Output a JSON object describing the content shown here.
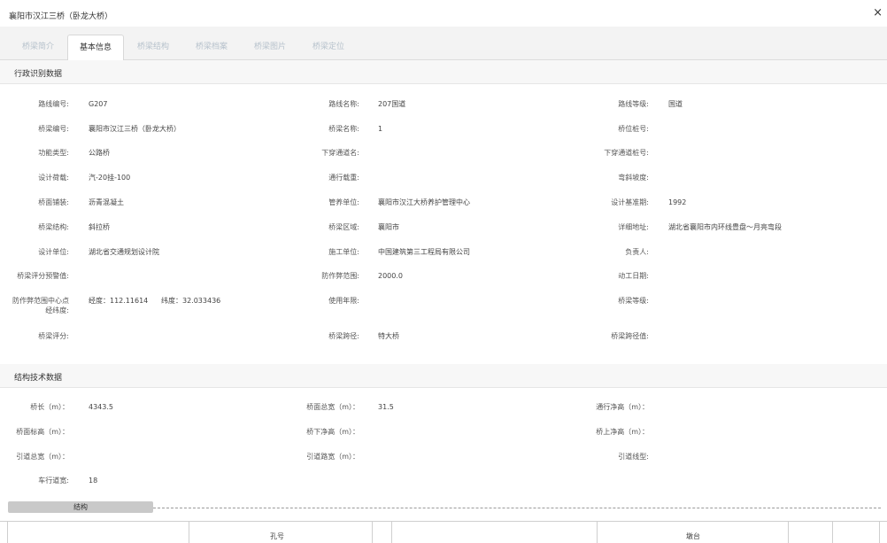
{
  "window": {
    "title": "襄阳市汉江三桥（卧龙大桥）",
    "close_symbol": "×"
  },
  "tabs": [
    {
      "label": "桥梁简介",
      "active": false
    },
    {
      "label": "基本信息",
      "active": true
    },
    {
      "label": "桥梁结构",
      "active": false
    },
    {
      "label": "桥梁档案",
      "active": false
    },
    {
      "label": "桥梁图片",
      "active": false
    },
    {
      "label": "桥梁定位",
      "active": false
    }
  ],
  "admin": {
    "heading": "行政识别数据",
    "route_no_label": "路线编号:",
    "route_no": "G207",
    "route_name_label": "路线名称:",
    "route_name": "207国道",
    "route_grade_label": "路线等级:",
    "route_grade": "国道",
    "bridge_no_label": "桥梁编号:",
    "bridge_no": "襄阳市汉江三桥（卧龙大桥）",
    "bridge_name_label": "桥梁名称:",
    "bridge_name": "1",
    "stake_label": "桥位桩号:",
    "function_type_label": "功能类型:",
    "function_type": "公路桥",
    "under_pass_name_label": "下穿通道名:",
    "under_pass_stake_label": "下穿通道桩号:",
    "design_load_label": "设计荷载:",
    "design_load": "汽-20挂-100",
    "traffic_load_label": "通行载重:",
    "skew_label": "弯斜坡度:",
    "deck_paving_label": "桥面铺装:",
    "deck_paving": "沥青混凝土",
    "maintain_unit_label": "管养单位:",
    "maintain_unit": "襄阳市汉江大桥养护管理中心",
    "design_ref_label": "设计基准期:",
    "design_ref": "1992",
    "structure_label": "桥梁结构:",
    "structure": "斜拉桥",
    "region_label": "桥梁区域:",
    "region": "襄阳市",
    "address_label": "详细地址:",
    "address": "湖北省襄阳市内环线豊盘～月亮弯段",
    "design_unit_label": "设计单位:",
    "design_unit": "湖北省交通规划设计院",
    "construction_unit_label": "施工单位:",
    "construction_unit": "中国建筑第三工程局有限公司",
    "leader_label": "负责人:",
    "warning_label": "桥梁评分预警值:",
    "flood_range_label": "防作弊范围:",
    "flood_range": "2000.0",
    "start_date_label": "动工日期:",
    "center_label": "防作弊范围中心点经纬度:",
    "lon_text": "经度：112.11614",
    "lat_text": "纬度：32.033436",
    "service_life_label": "使用年限:",
    "bridge_grade_label": "桥梁等级:",
    "score_label": "桥梁评分:",
    "span_label": "桥梁跨径:",
    "span": "特大桥",
    "span_value_label": "桥梁跨径值:"
  },
  "tech": {
    "heading": "结构技术数据",
    "length_label": "桥长（m）：",
    "length": "4343.5",
    "deck_width_label": "桥面总宽（m）：",
    "deck_width": "31.5",
    "clear_height_label": "通行净高（m）：",
    "deck_elev_label": "桥面标高（m）：",
    "under_clear_label": "桥下净高（m）：",
    "over_clear_label": "桥上净高（m）：",
    "approach_width_label": "引道总宽（m）：",
    "approach_road_label": "引道路宽（m）：",
    "approach_line_label": "引道线型:",
    "lane_width_label": "车行道宽:",
    "lane_width": "18"
  },
  "subsection": {
    "tab_label": "结构"
  },
  "grid": {
    "col1": "孔号",
    "col2": "墩台"
  }
}
